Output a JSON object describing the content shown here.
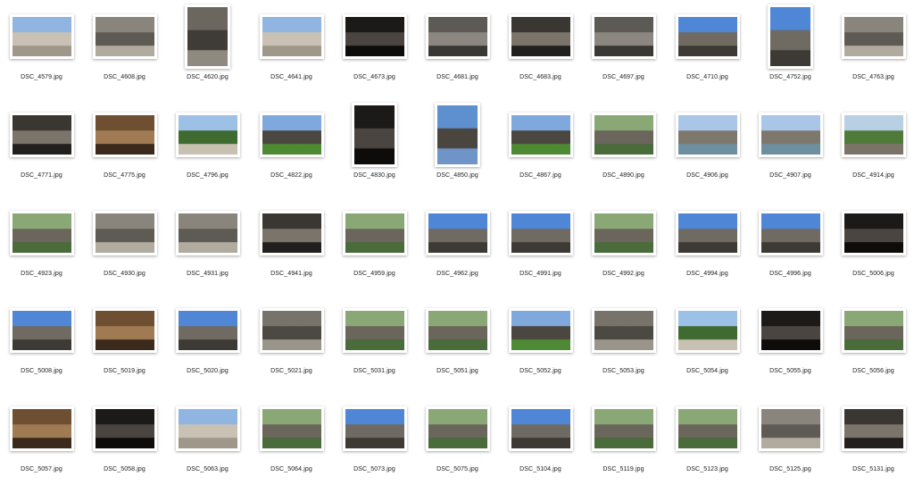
{
  "window": {
    "view": "icon-grid"
  },
  "rows": [
    [
      {
        "name": "DSC_4579.jpg",
        "orient": "landscape",
        "tone": "sky-plaza"
      },
      {
        "name": "DSC_4608.jpg",
        "orient": "landscape",
        "tone": "stone-relief"
      },
      {
        "name": "DSC_4620.jpg",
        "orient": "portrait",
        "tone": "carved-wall"
      },
      {
        "name": "DSC_4641.jpg",
        "orient": "landscape",
        "tone": "sky-plaza"
      },
      {
        "name": "DSC_4673.jpg",
        "orient": "landscape",
        "tone": "dark-window"
      },
      {
        "name": "DSC_4681.jpg",
        "orient": "landscape",
        "tone": "courtyard"
      },
      {
        "name": "DSC_4683.jpg",
        "orient": "landscape",
        "tone": "corridor"
      },
      {
        "name": "DSC_4697.jpg",
        "orient": "landscape",
        "tone": "courtyard"
      },
      {
        "name": "DSC_4710.jpg",
        "orient": "landscape",
        "tone": "sky-tower"
      },
      {
        "name": "DSC_4752.jpg",
        "orient": "portrait",
        "tone": "sky-tower"
      },
      {
        "name": "DSC_4763.jpg",
        "orient": "landscape",
        "tone": "stone-relief"
      }
    ],
    [
      {
        "name": "DSC_4771.jpg",
        "orient": "landscape",
        "tone": "corridor"
      },
      {
        "name": "DSC_4775.jpg",
        "orient": "landscape",
        "tone": "warm-hall"
      },
      {
        "name": "DSC_4796.jpg",
        "orient": "landscape",
        "tone": "trees-path"
      },
      {
        "name": "DSC_4822.jpg",
        "orient": "landscape",
        "tone": "temple-green"
      },
      {
        "name": "DSC_4830.jpg",
        "orient": "portrait",
        "tone": "dark-window"
      },
      {
        "name": "DSC_4850.jpg",
        "orient": "portrait",
        "tone": "reflection"
      },
      {
        "name": "DSC_4867.jpg",
        "orient": "landscape",
        "tone": "temple-green"
      },
      {
        "name": "DSC_4890.jpg",
        "orient": "landscape",
        "tone": "ruins-trees"
      },
      {
        "name": "DSC_4906.jpg",
        "orient": "landscape",
        "tone": "statues-water"
      },
      {
        "name": "DSC_4907.jpg",
        "orient": "landscape",
        "tone": "statues-water"
      },
      {
        "name": "DSC_4914.jpg",
        "orient": "landscape",
        "tone": "statues-trees"
      }
    ],
    [
      {
        "name": "DSC_4923.jpg",
        "orient": "landscape",
        "tone": "ruins-trees"
      },
      {
        "name": "DSC_4930.jpg",
        "orient": "landscape",
        "tone": "stone-relief"
      },
      {
        "name": "DSC_4931.jpg",
        "orient": "landscape",
        "tone": "stone-relief"
      },
      {
        "name": "DSC_4941.jpg",
        "orient": "landscape",
        "tone": "corridor"
      },
      {
        "name": "DSC_4959.jpg",
        "orient": "landscape",
        "tone": "ruins-trees"
      },
      {
        "name": "DSC_4962.jpg",
        "orient": "landscape",
        "tone": "sky-tower"
      },
      {
        "name": "DSC_4991.jpg",
        "orient": "landscape",
        "tone": "sky-tower"
      },
      {
        "name": "DSC_4992.jpg",
        "orient": "landscape",
        "tone": "ruins-trees"
      },
      {
        "name": "DSC_4994.jpg",
        "orient": "landscape",
        "tone": "sky-tower"
      },
      {
        "name": "DSC_4996.jpg",
        "orient": "landscape",
        "tone": "sky-tower"
      },
      {
        "name": "DSC_5006.jpg",
        "orient": "landscape",
        "tone": "dark-window"
      }
    ],
    [
      {
        "name": "DSC_5008.jpg",
        "orient": "landscape",
        "tone": "sky-tower"
      },
      {
        "name": "DSC_5019.jpg",
        "orient": "landscape",
        "tone": "warm-hall"
      },
      {
        "name": "DSC_5020.jpg",
        "orient": "landscape",
        "tone": "sky-tower"
      },
      {
        "name": "DSC_5021.jpg",
        "orient": "landscape",
        "tone": "rubble"
      },
      {
        "name": "DSC_5031.jpg",
        "orient": "landscape",
        "tone": "ruins-trees"
      },
      {
        "name": "DSC_5051.jpg",
        "orient": "landscape",
        "tone": "ruins-trees"
      },
      {
        "name": "DSC_5052.jpg",
        "orient": "landscape",
        "tone": "temple-green"
      },
      {
        "name": "DSC_5053.jpg",
        "orient": "landscape",
        "tone": "rubble"
      },
      {
        "name": "DSC_5054.jpg",
        "orient": "landscape",
        "tone": "trees-path"
      },
      {
        "name": "DSC_5055.jpg",
        "orient": "landscape",
        "tone": "dark-window"
      },
      {
        "name": "DSC_5056.jpg",
        "orient": "landscape",
        "tone": "ruins-trees"
      }
    ],
    [
      {
        "name": "DSC_5057.jpg",
        "orient": "landscape",
        "tone": "warm-hall"
      },
      {
        "name": "DSC_5058.jpg",
        "orient": "landscape",
        "tone": "dark-window"
      },
      {
        "name": "DSC_5063.jpg",
        "orient": "landscape",
        "tone": "sky-plaza"
      },
      {
        "name": "DSC_5064.jpg",
        "orient": "landscape",
        "tone": "ruins-trees"
      },
      {
        "name": "DSC_5073.jpg",
        "orient": "landscape",
        "tone": "sky-tower"
      },
      {
        "name": "DSC_5075.jpg",
        "orient": "landscape",
        "tone": "ruins-trees"
      },
      {
        "name": "DSC_5104.jpg",
        "orient": "landscape",
        "tone": "sky-tower"
      },
      {
        "name": "DSC_5119.jpg",
        "orient": "landscape",
        "tone": "ruins-trees"
      },
      {
        "name": "DSC_5123.jpg",
        "orient": "landscape",
        "tone": "ruins-trees"
      },
      {
        "name": "DSC_5125.jpg",
        "orient": "landscape",
        "tone": "stone-relief"
      },
      {
        "name": "DSC_5131.jpg",
        "orient": "landscape",
        "tone": "corridor"
      }
    ]
  ],
  "tones": {
    "sky-plaza": [
      "#8fb5e0",
      "#c9c2b4",
      "#9e978a"
    ],
    "stone-relief": [
      "#8a857c",
      "#5e5a54",
      "#b0aa9f"
    ],
    "carved-wall": [
      "#6b665e",
      "#3f3c38",
      "#8f8a80"
    ],
    "dark-window": [
      "#1c1a18",
      "#4a4540",
      "#0d0c0b"
    ],
    "courtyard": [
      "#5d5a55",
      "#8b8780",
      "#3a3835"
    ],
    "corridor": [
      "#3a3733",
      "#7a746a",
      "#22201e"
    ],
    "sky-tower": [
      "#4f86d6",
      "#6f6a62",
      "#3d3a36"
    ],
    "warm-hall": [
      "#6e4f32",
      "#a07a52",
      "#3b2a1b"
    ],
    "trees-path": [
      "#9cc0e6",
      "#3f6b30",
      "#c8c0b0"
    ],
    "temple-green": [
      "#7fa8dc",
      "#4b4740",
      "#4e8a34"
    ],
    "reflection": [
      "#5e8fcf",
      "#4a453e",
      "#6f95c8"
    ],
    "ruins-trees": [
      "#8aa876",
      "#6b665b",
      "#4a6b3a"
    ],
    "statues-water": [
      "#a9c6e8",
      "#7e786c",
      "#6d8fa0"
    ],
    "statues-trees": [
      "#b8cfe4",
      "#4f7a3a",
      "#7a7468"
    ],
    "rubble": [
      "#77736a",
      "#4c4943",
      "#9a958a"
    ]
  }
}
